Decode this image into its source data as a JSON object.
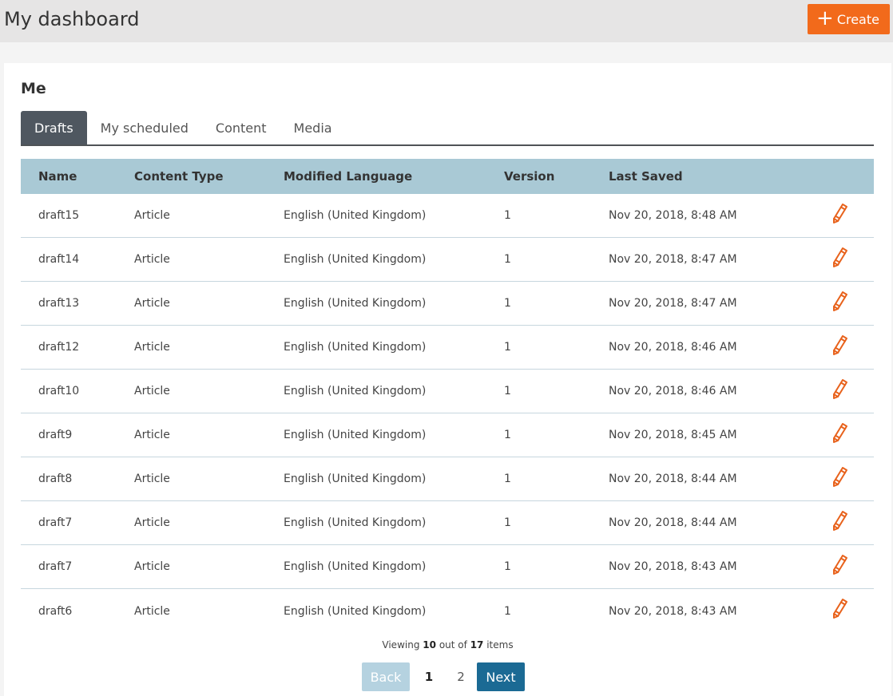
{
  "header": {
    "title": "My dashboard",
    "create_label": "Create",
    "create_icon": "plus-icon"
  },
  "panel": {
    "title": "Me"
  },
  "tabs": [
    {
      "label": "Drafts",
      "active": true
    },
    {
      "label": "My scheduled",
      "active": false
    },
    {
      "label": "Content",
      "active": false
    },
    {
      "label": "Media",
      "active": false
    }
  ],
  "table": {
    "columns": [
      "Name",
      "Content Type",
      "Modified Language",
      "Version",
      "Last Saved"
    ],
    "rows": [
      {
        "name": "draft15",
        "type": "Article",
        "language": "English (United Kingdom)",
        "version": "1",
        "saved": "Nov 20, 2018, 8:48 AM"
      },
      {
        "name": "draft14",
        "type": "Article",
        "language": "English (United Kingdom)",
        "version": "1",
        "saved": "Nov 20, 2018, 8:47 AM"
      },
      {
        "name": "draft13",
        "type": "Article",
        "language": "English (United Kingdom)",
        "version": "1",
        "saved": "Nov 20, 2018, 8:47 AM"
      },
      {
        "name": "draft12",
        "type": "Article",
        "language": "English (United Kingdom)",
        "version": "1",
        "saved": "Nov 20, 2018, 8:46 AM"
      },
      {
        "name": "draft10",
        "type": "Article",
        "language": "English (United Kingdom)",
        "version": "1",
        "saved": "Nov 20, 2018, 8:46 AM"
      },
      {
        "name": "draft9",
        "type": "Article",
        "language": "English (United Kingdom)",
        "version": "1",
        "saved": "Nov 20, 2018, 8:45 AM"
      },
      {
        "name": "draft8",
        "type": "Article",
        "language": "English (United Kingdom)",
        "version": "1",
        "saved": "Nov 20, 2018, 8:44 AM"
      },
      {
        "name": "draft7",
        "type": "Article",
        "language": "English (United Kingdom)",
        "version": "1",
        "saved": "Nov 20, 2018, 8:44 AM"
      },
      {
        "name": "draft7",
        "type": "Article",
        "language": "English (United Kingdom)",
        "version": "1",
        "saved": "Nov 20, 2018, 8:43 AM"
      },
      {
        "name": "draft6",
        "type": "Article",
        "language": "English (United Kingdom)",
        "version": "1",
        "saved": "Nov 20, 2018, 8:43 AM"
      }
    ],
    "edit_icon": "pencil-icon"
  },
  "pagination": {
    "viewing_prefix": "Viewing",
    "viewing_count": "10",
    "viewing_mid": "out of",
    "total": "17",
    "viewing_suffix": "items",
    "back_label": "Back",
    "next_label": "Next",
    "pages": [
      "1",
      "2"
    ],
    "current_page": "1"
  },
  "colors": {
    "accent": "#f26a1b",
    "header_row": "#a9c9d5",
    "active_tab": "#4f5760",
    "next_button": "#1b6a94",
    "back_button_disabled": "#b5d2e0"
  }
}
